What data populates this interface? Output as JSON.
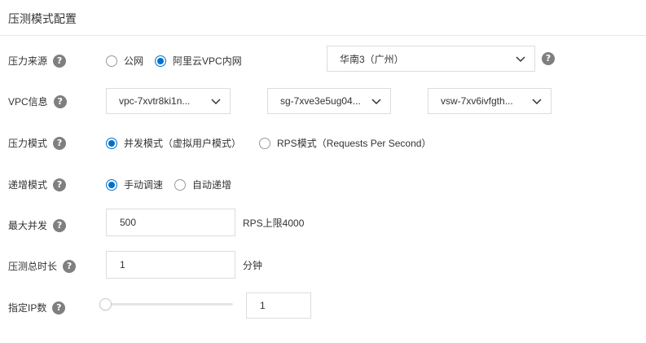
{
  "header": {
    "title": "压测模式配置"
  },
  "source": {
    "label": "压力来源",
    "options": [
      "公网",
      "阿里云VPC内网"
    ],
    "region": "华南3（广州）"
  },
  "vpc": {
    "label": "VPC信息",
    "vpc_value": "vpc-7xvtr8ki1n...",
    "sg_value": "sg-7xve3e5ug04...",
    "vsw_value": "vsw-7xv6ivfgth..."
  },
  "mode": {
    "label": "压力模式",
    "options": [
      "并发模式（虚拟用户模式）",
      "RPS模式（Requests Per Second）"
    ]
  },
  "ramp": {
    "label": "递增模式",
    "options": [
      "手动调速",
      "自动递增"
    ]
  },
  "max_concurrency": {
    "label": "最大并发",
    "value": "500",
    "suffix": "RPS上限4000"
  },
  "duration": {
    "label": "压测总时长",
    "value": "1",
    "suffix": "分钟"
  },
  "ip_count": {
    "label": "指定IP数",
    "value": "1",
    "slider_level": 0
  },
  "help_glyph": "?",
  "colors": {
    "accent": "#0070cc",
    "help_icon": "#7f7f7f",
    "border": "#dcdcdc"
  }
}
